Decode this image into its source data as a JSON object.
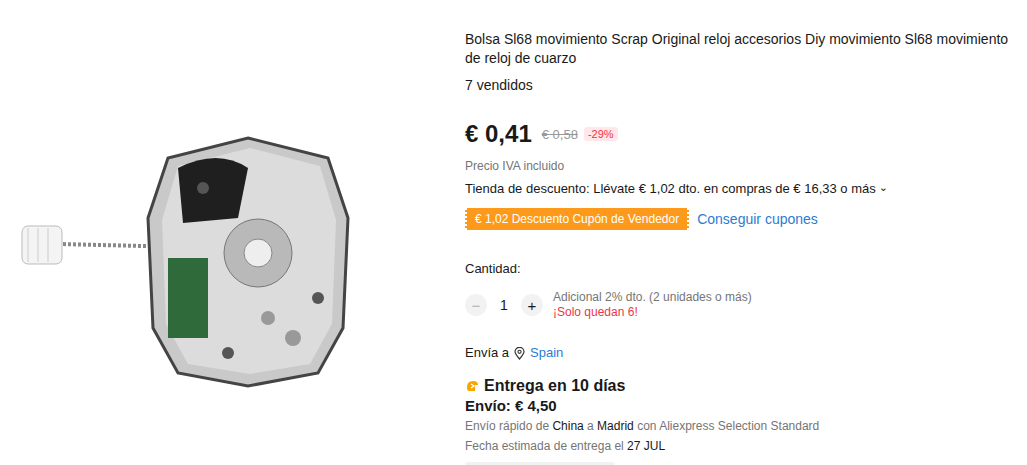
{
  "product": {
    "title": "Bolsa Sl68 movimiento Scrap Original reloj accesorios Diy movimiento Sl68 movimiento de reloj de cuarzo",
    "sold": "7 vendidos"
  },
  "price": {
    "current": "€ 0,41",
    "original": "€ 0,58",
    "discount": "-29%",
    "tax_note": "Precio IVA incluido"
  },
  "store_promo": {
    "text": "Tienda de descuento: Llévate € 1,02 dto. en compras de € 16,33 o más",
    "chevron": "⌄"
  },
  "coupon": {
    "label": "€ 1,02 Descuento Cupón de Vendedor",
    "link": "Conseguir cupones"
  },
  "quantity": {
    "label": "Cantidad:",
    "value": "1",
    "minus": "−",
    "plus": "+",
    "minus_disabled": true,
    "bulk_note": "Adicional 2% dto. (2 unidades o más)",
    "stock_note": "¡Solo quedan 6!"
  },
  "ship_to": {
    "label": "Envía a",
    "country": "Spain"
  },
  "delivery": {
    "title": "Entrega en 10 días",
    "cost": "Envío: € 4,50",
    "route": [
      {
        "text": "Envío rápido de ",
        "strong": false
      },
      {
        "text": "China",
        "strong": true
      },
      {
        "text": " a ",
        "strong": false
      },
      {
        "text": "Madrid",
        "strong": true
      },
      {
        "text": " con Aliexpress Selection Standard",
        "strong": false
      }
    ],
    "estimate": [
      {
        "text": "Fecha estimada de entrega el ",
        "strong": false
      },
      {
        "text": "27 JUL",
        "strong": true
      }
    ]
  }
}
